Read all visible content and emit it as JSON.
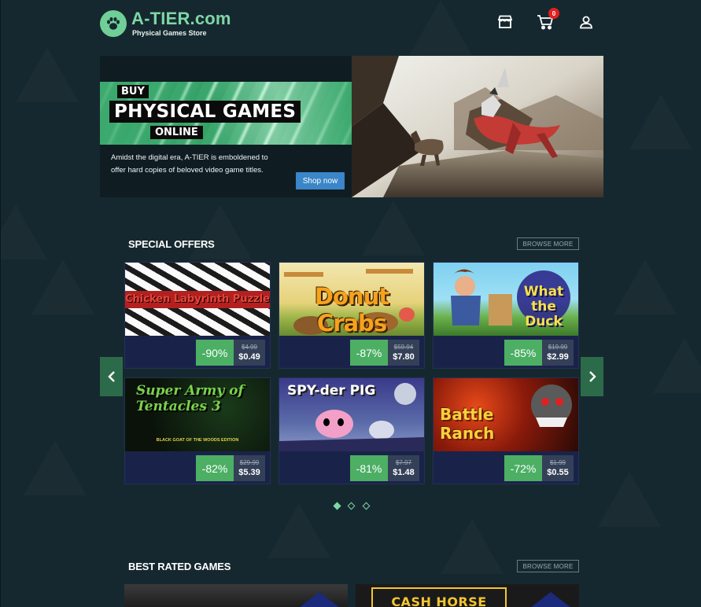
{
  "brand": {
    "title": "A-TIER.com",
    "subtitle": "Physical Games Store"
  },
  "header": {
    "cart_count": "0"
  },
  "icons": {
    "store": "store-icon",
    "cart": "cart-icon",
    "user": "user-icon",
    "logo": "paw-icon"
  },
  "hero": {
    "banner_line1": "BUY",
    "banner_line2": "PHYSICAL GAMES",
    "banner_line3": "ONLINE",
    "description": "Amidst the digital era, A-TIER is emboldened to offer hard copies of beloved video game titles.",
    "cta_label": "Shop now"
  },
  "special_offers": {
    "title": "SPECIAL OFFERS",
    "browse_label": "BROWSE MORE",
    "items": [
      {
        "title": "Chicken Labyrinth Puzzles",
        "discount": "-90%",
        "original_price": "$4.99",
        "final_price": "$0.49"
      },
      {
        "title": "Donut Crabs",
        "discount": "-87%",
        "original_price": "$59.94",
        "final_price": "$7.80"
      },
      {
        "title": "What the Duck",
        "discount": "-85%",
        "original_price": "$19.99",
        "final_price": "$2.99"
      },
      {
        "title": "Super Army of Tentacles 3",
        "subtitle": "BLACK GOAT OF THE WOODS EDITION",
        "discount": "-82%",
        "original_price": "$29.99",
        "final_price": "$5.39"
      },
      {
        "title": "SPY-der PIG",
        "discount": "-81%",
        "original_price": "$7.97",
        "final_price": "$1.48"
      },
      {
        "title": "Battle Ranch",
        "discount": "-72%",
        "original_price": "$1.99",
        "final_price": "$0.55"
      }
    ],
    "pages": 3,
    "active_page": 0
  },
  "best_rated": {
    "title": "BEST RATED GAMES",
    "browse_label": "BROWSE MORE",
    "visible_titles": [
      "",
      "CASH HORSE"
    ]
  },
  "colors": {
    "accent": "#7ed6a6",
    "discount": "#4caf64",
    "card": "#19234a",
    "cta": "#3a86c8",
    "background": "#16282f"
  }
}
